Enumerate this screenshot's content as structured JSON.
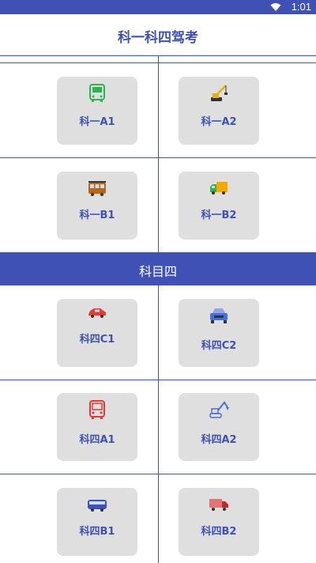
{
  "status_bar": {
    "time": "1:01",
    "wifi_icon": "wifi-icon"
  },
  "header": {
    "title": "科一科四驾考"
  },
  "section_top": {
    "cards": [
      {
        "label": "科一A1",
        "icon": "bus-icon",
        "color": "#2fb34f"
      },
      {
        "label": "科一A2",
        "icon": "crane-icon",
        "color": "#e8b100"
      },
      {
        "label": "科一B1",
        "icon": "tram-icon",
        "color": "#b5651d"
      },
      {
        "label": "科一B2",
        "icon": "truck-icon",
        "color": "#f2a900"
      }
    ]
  },
  "section_four": {
    "title": "科目四",
    "cards": [
      {
        "label": "科四C1",
        "icon": "car-icon",
        "color": "#e53935"
      },
      {
        "label": "科四C2",
        "icon": "suv-icon",
        "color": "#4a6fd1"
      },
      {
        "label": "科四A1",
        "icon": "bus-front-icon",
        "color": "#e53935"
      },
      {
        "label": "科四A2",
        "icon": "excavator-icon",
        "color": "#4a6fd1"
      },
      {
        "label": "科四B1",
        "icon": "coach-icon",
        "color": "#3f51b5"
      },
      {
        "label": "科四B2",
        "icon": "lorry-icon",
        "color": "#e57373"
      }
    ]
  },
  "colors": {
    "primary": "#3f51b5",
    "card_bg": "#e0dfdf"
  }
}
